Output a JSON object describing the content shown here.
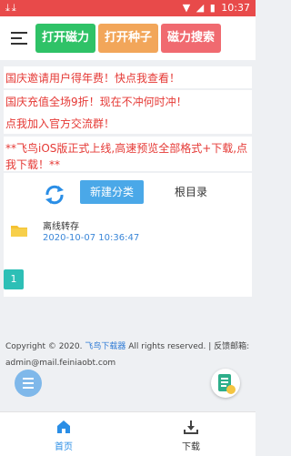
{
  "status_bar": {
    "time": "10:37"
  },
  "toolbar": {
    "buttons": [
      "打开磁力",
      "打开种子",
      "磁力搜索"
    ]
  },
  "notices": [
    "国庆邀请用户得年费！快点我查看！",
    "国庆充值全场9折！现在不冲何时冲！",
    "点我加入官方交流群！",
    "**飞鸟iOS版正式上线,高速预览全部格式+下载,点我下载！**"
  ],
  "files_panel": {
    "new_folder_label": "新建分类",
    "root_label": "根目录",
    "items": [
      {
        "name": "离线转存",
        "date": "2020-10-07 10:36:47"
      }
    ],
    "page": "1"
  },
  "footer": {
    "copyright_prefix": "Copyright © 2020.",
    "brand": "飞鸟下载器",
    "copyright_suffix": "All rights reserved. | 反馈邮箱:",
    "email": "admin@mail.feiniaobt.com"
  },
  "bottom_nav": {
    "items": [
      {
        "label": "首页",
        "icon": "home-icon",
        "active": true
      },
      {
        "label": "下载",
        "icon": "download-icon",
        "active": false
      }
    ]
  },
  "colors": {
    "status_bar": "#e84a4a",
    "accent_blue": "#2a8ee6",
    "notice_red": "#e53935",
    "green": "#2fc267",
    "orange": "#f2a65a",
    "pink": "#f06a70",
    "teal": "#2dbfb6"
  }
}
